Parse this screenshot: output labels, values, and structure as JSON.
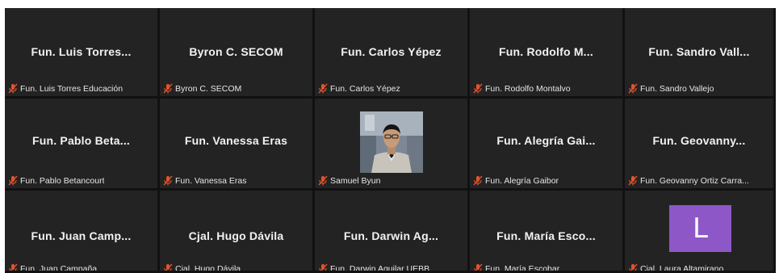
{
  "colors": {
    "tile_bg": "#232323",
    "gap": "#111111",
    "muted_mic": "#e0532e",
    "avatar_bg": "#8e57c7"
  },
  "participants": [
    {
      "display": "Fun. Luis Torres...",
      "tag": "Fun. Luis Torres Educación",
      "muted": true
    },
    {
      "display": "Byron C. SECOM",
      "tag": "Byron C. SECOM",
      "muted": true
    },
    {
      "display": "Fun. Carlos Yépez",
      "tag": "Fun. Carlos Yépez",
      "muted": true
    },
    {
      "display": "Fun. Rodolfo M...",
      "tag": "Fun. Rodolfo Montalvo",
      "muted": true
    },
    {
      "display": "Fun. Sandro Vall...",
      "tag": "Fun. Sandro Vallejo",
      "muted": true
    },
    {
      "display": "Fun. Pablo Beta...",
      "tag": "Fun. Pablo Betancourt",
      "muted": true
    },
    {
      "display": "Fun. Vanessa Eras",
      "tag": "Fun. Vanessa Eras",
      "muted": true
    },
    {
      "display": "",
      "tag": "Samuel Byun",
      "muted": true,
      "video": true
    },
    {
      "display": "Fun. Alegría Gai...",
      "tag": "Fun. Alegría Gaibor",
      "muted": true
    },
    {
      "display": "Fun. Geovanny...",
      "tag": "Fun. Geovanny Ortiz Carra...",
      "muted": true
    },
    {
      "display": "Fun. Juan Camp...",
      "tag": "Fun. Juan Campaña",
      "muted": true
    },
    {
      "display": "Cjal. Hugo Dávila",
      "tag": "Cjal. Hugo Dávila",
      "muted": true
    },
    {
      "display": "Fun. Darwin Ag...",
      "tag": "Fun. Darwin Aguilar UEBB",
      "muted": true
    },
    {
      "display": "Fun. María Esco...",
      "tag": "Fun. María Escobar",
      "muted": true
    },
    {
      "display": "",
      "tag": "Cjal. Laura Altamirano",
      "muted": true,
      "avatar_letter": "L"
    }
  ]
}
